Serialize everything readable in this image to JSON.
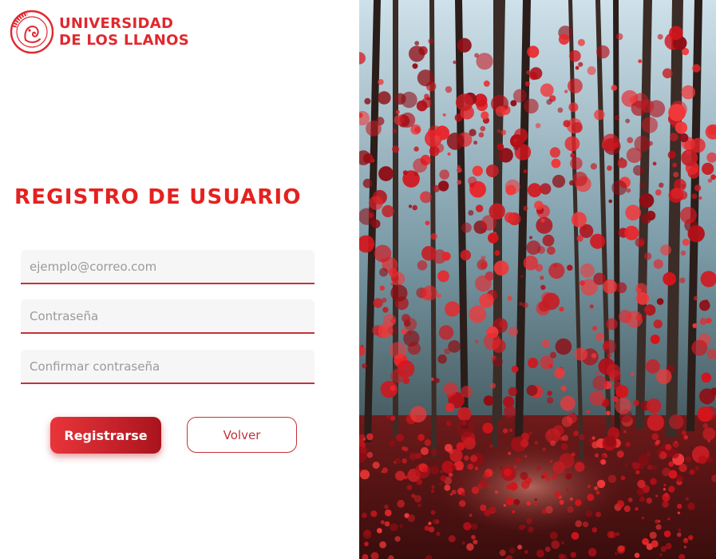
{
  "brand": {
    "line1": "UNIVERSIDAD",
    "line2": "DE LOS LLANOS",
    "seal_text": "UNILLANOS",
    "color": "#e0282e"
  },
  "page_title": "REGISTRO DE USUARIO",
  "form": {
    "email_placeholder": "ejemplo@correo.com",
    "password_placeholder": "Contraseña",
    "confirm_placeholder": "Confirmar contraseña",
    "register_label": "Registrarse",
    "back_label": "Volver"
  },
  "colors": {
    "accent": "#e5211f",
    "button_dark": "#a8141c",
    "input_underline": "#c6313a",
    "input_bg": "#f6f6f6"
  },
  "icons": {
    "logo": "owl-seal-icon"
  }
}
